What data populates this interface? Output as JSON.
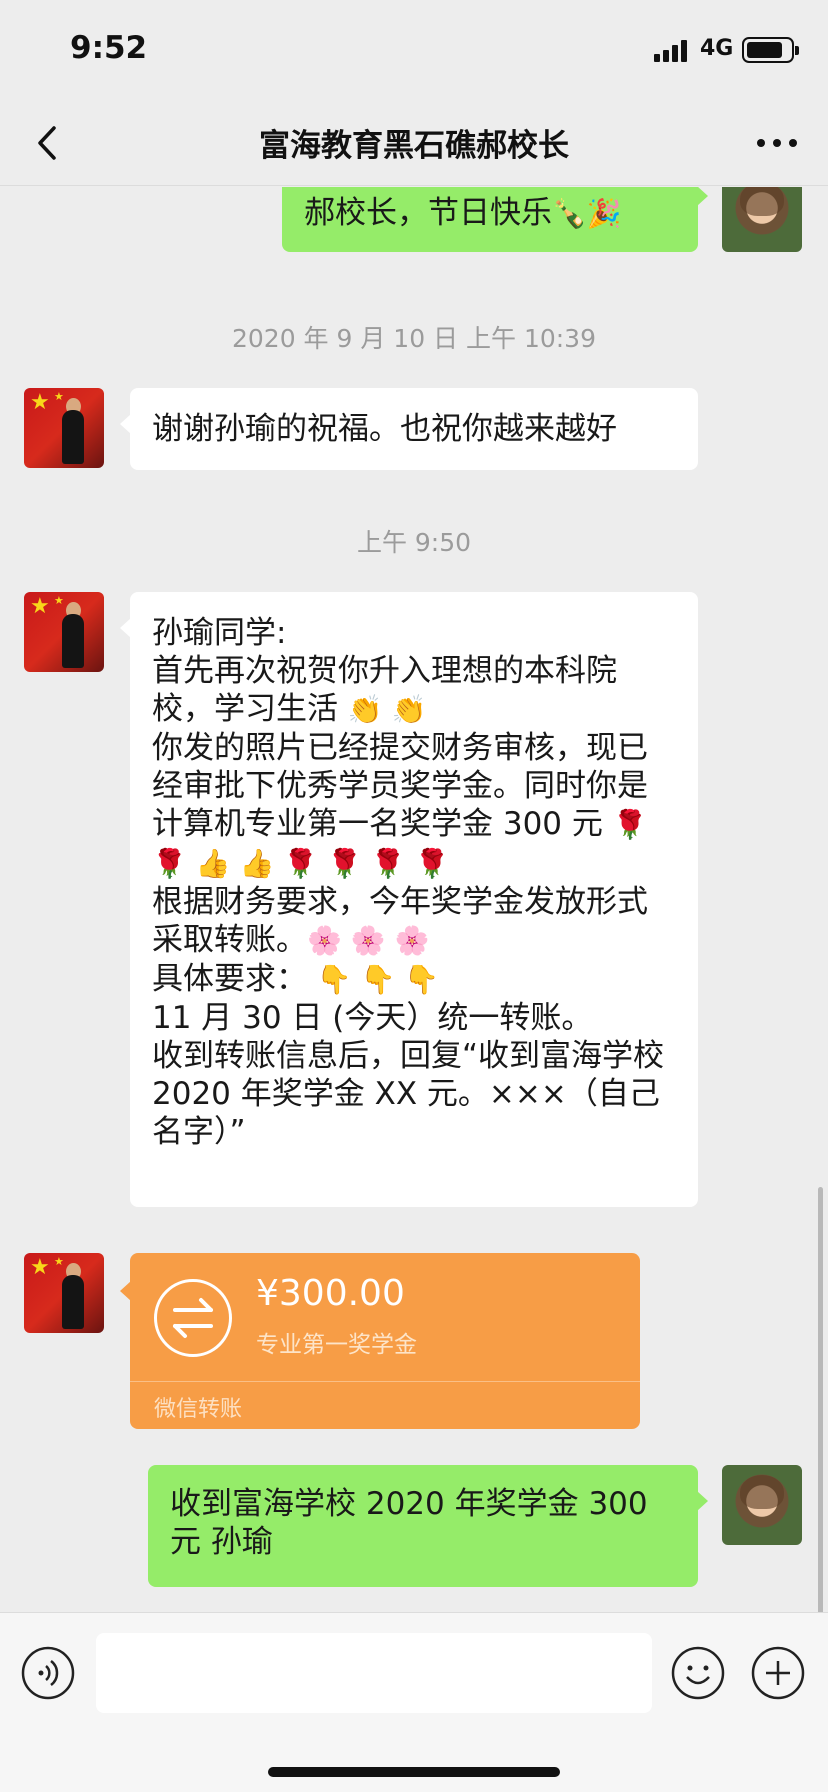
{
  "status_bar": {
    "time": "9:52",
    "network": "4G"
  },
  "nav": {
    "title": "富海教育黑石礁郝校长"
  },
  "messages": {
    "m1": {
      "text": "郝校长，节日快乐",
      "emoji": "🍾🎉"
    },
    "t1": "2020 年 9 月 10 日 上午 10:39",
    "m2": {
      "text": "谢谢孙瑜的祝福。也祝你越来越好"
    },
    "t2": "上午 9:50",
    "m3": {
      "line1": "孙瑜同学:",
      "line2": "首先再次祝贺你升入理想的本科院校，学习生活",
      "emoji_clap": "👏 👏",
      "line3": "你发的照片已经提交财务审核，现已经审批下优秀学员奖学金。同时你是计算机专业第一名奖学金 300 元",
      "emoji_roses": "🌹 🌹 👍 👍 🌹 🌹 🌹 🌹",
      "line4": "根据财务要求，今年奖学金发放形式采取转账。",
      "emoji_flowers": "🌸 🌸 🌸",
      "line5": "具体要求：",
      "emoji_point": "👇 👇 👇",
      "line6": "11 月 30 日 (今天）统一转账。",
      "line7": "收到转账信息后，回复“收到富海学校 2020 年奖学金 XX 元。×××（自己名字）”"
    },
    "transfer": {
      "amount": "¥300.00",
      "description": "专业第一奖学金",
      "label": "微信转账"
    },
    "m4": {
      "text": "收到富海学校 2020 年奖学金 300 元 孙瑜"
    }
  },
  "input": {
    "placeholder": ""
  },
  "colors": {
    "green_bubble": "#95ec69",
    "transfer": "#f79d46",
    "background": "#ededed"
  }
}
